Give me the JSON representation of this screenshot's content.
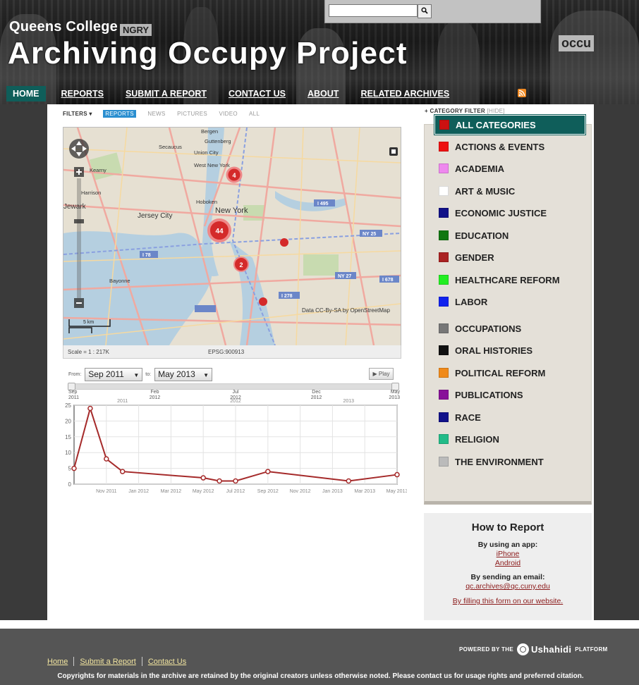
{
  "header": {
    "subtitle": "Queens College",
    "title": "Archiving Occupy Project",
    "search": {
      "placeholder": "",
      "button_icon": "search-icon"
    },
    "nav": [
      {
        "label": "HOME",
        "active": true
      },
      {
        "label": "REPORTS"
      },
      {
        "label": "SUBMIT A REPORT"
      },
      {
        "label": "CONTACT US"
      },
      {
        "label": "ABOUT"
      },
      {
        "label": "RELATED ARCHIVES"
      }
    ],
    "rss_icon": "rss-icon"
  },
  "filters": {
    "label": "FILTERS",
    "items": [
      "REPORTS",
      "NEWS",
      "PICTURES",
      "VIDEO",
      "ALL"
    ],
    "active": "REPORTS"
  },
  "map": {
    "labels": [
      "Bergen",
      "Secaucus",
      "Union City",
      "Guttenberg",
      "West New York",
      "Kearny",
      "Harrison",
      "Jewark",
      "Jersey City",
      "Hoboken",
      "New York",
      "Bayonne"
    ],
    "road_labels": [
      "I 495",
      "NY 25",
      "I 78",
      "NY 27",
      "I 678",
      "I 278"
    ],
    "clusters": [
      {
        "count": "4"
      },
      {
        "count": "44"
      },
      {
        "count": "2"
      },
      {
        "count": ""
      },
      {
        "count": ""
      }
    ],
    "attribution": "Data CC-By-SA by OpenStreetMap",
    "scale_bar": "5 km",
    "scale": "Scale = 1 : 217K",
    "projection": "EPSG:900913"
  },
  "timeline": {
    "from_label": "From:",
    "to_label": "to:",
    "from": "Sep 2011",
    "to": "May 2013",
    "play": "Play",
    "slider_ticks": [
      {
        "top": "Sep",
        "bottom": "2011"
      },
      {
        "top": "Feb",
        "bottom": "2012"
      },
      {
        "top": "Jul",
        "bottom": "2012"
      },
      {
        "top": "Dec",
        "bottom": "2012"
      },
      {
        "top": "May",
        "bottom": "2013"
      }
    ],
    "year_labels": [
      "2011",
      "2012",
      "2013"
    ]
  },
  "chart_data": {
    "type": "line",
    "x": [
      "Sep 2011",
      "Oct 2011",
      "Nov 2011",
      "Dec 2011",
      "May 2012",
      "Jun 2012",
      "Jul 2012",
      "Sep 2012",
      "Feb 2013",
      "May 2013"
    ],
    "values": [
      5,
      24,
      8,
      4,
      2,
      1,
      1,
      4,
      1,
      3
    ],
    "x_tick_labels": [
      "Nov 2011",
      "Jan 2012",
      "Mar 2012",
      "May 2012",
      "Jul 2012",
      "Sep 2012",
      "Nov 2012",
      "Jan 2013",
      "Mar 2013",
      "May 2013"
    ],
    "y_ticks": [
      0,
      5,
      10,
      15,
      20,
      25
    ],
    "ylim": [
      0,
      25
    ],
    "color": "#a52a2a",
    "grid": true
  },
  "sidebar": {
    "category_filter": "CATEGORY FILTER",
    "hide": "[HIDE]",
    "categories": [
      {
        "label": "ALL CATEGORIES",
        "color": "#cc1111",
        "active": true
      },
      {
        "label": "ACTIONS & EVENTS",
        "color": "#ee1111"
      },
      {
        "label": "ACADEMIA",
        "color": "#ee88ee"
      },
      {
        "label": "ART & MUSIC",
        "color": "#ffffff"
      },
      {
        "label": "ECONOMIC JUSTICE",
        "color": "#111188"
      },
      {
        "label": "EDUCATION",
        "color": "#117711"
      },
      {
        "label": "GENDER",
        "color": "#aa2222"
      },
      {
        "label": "HEALTHCARE REFORM",
        "color": "#22ee22"
      },
      {
        "label": "LABOR",
        "color": "#1122ee"
      },
      {
        "label": "OCCUPATIONS",
        "color": "#777777"
      },
      {
        "label": "ORAL HISTORIES",
        "color": "#111111"
      },
      {
        "label": "POLITICAL REFORM",
        "color": "#f08a1a"
      },
      {
        "label": "PUBLICATIONS",
        "color": "#881199"
      },
      {
        "label": "RACE",
        "color": "#11118a"
      },
      {
        "label": "RELIGION",
        "color": "#22bb88"
      },
      {
        "label": "THE ENVIRONMENT",
        "color": "#bbbbbb"
      }
    ],
    "howto": {
      "title": "How to Report",
      "app_label": "By using an app:",
      "iphone": "iPhone",
      "android": "Android",
      "email_label": "By sending an email:",
      "email": "qc.archives@qc.cuny.edu",
      "form": "By filling this form on our website."
    }
  },
  "footer": {
    "powered_by": "POWERED BY THE",
    "platform_name": "Ushahidi",
    "platform": "PLATFORM",
    "links": [
      "Home",
      "Submit a Report",
      "Contact Us"
    ],
    "copyright": "Copyrights for materials in the archive are retained by the original creators unless otherwise noted. Please contact us for usage rights and preferred citation."
  }
}
